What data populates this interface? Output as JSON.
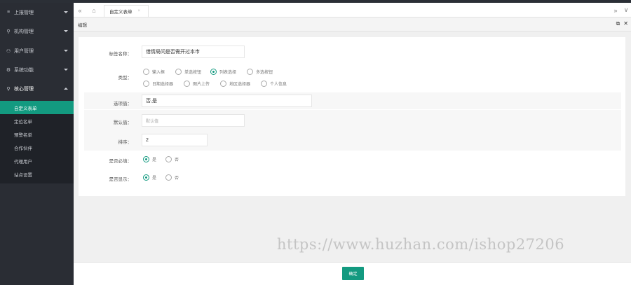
{
  "sidebar": {
    "menu": [
      {
        "icon": "≡",
        "label": "上报管理"
      },
      {
        "icon": "⚲",
        "label": "机构管理"
      },
      {
        "icon": "⚇",
        "label": "用户管理"
      },
      {
        "icon": "⚙",
        "label": "系统功能"
      },
      {
        "icon": "⚲",
        "label": "核心管理"
      }
    ],
    "submenu": [
      "自定义表单",
      "定位名单",
      "预警名单",
      "合作伙伴",
      "代理用户",
      "站点设置"
    ]
  },
  "tabbar": {
    "prev": "«",
    "home": "⌂",
    "next": "»",
    "dropdown": "∨",
    "tab_label": "自定义表单",
    "tab_close": "×"
  },
  "panel": {
    "title": "编辑",
    "tools": [
      "⧉",
      "✕"
    ]
  },
  "form": {
    "field_name_label": "标签名称：",
    "field_name_value": "借情局问是否需开过本市",
    "type_label": "类型：",
    "type_options": [
      "输入框",
      "单选按钮",
      "列表选择",
      "多选按钮",
      "日期选择器",
      "图片上传",
      "地区选择器",
      "个人信息"
    ],
    "type_selected": "列表选择",
    "options_label": "选项值：",
    "options_value": "否,是",
    "default_label": "默认值：",
    "default_placeholder": "默认值",
    "sort_label": "排序：",
    "sort_value": "2",
    "required_label": "是否必填：",
    "show_label": "是否显示：",
    "yes": "是",
    "no": "否"
  },
  "footer": {
    "confirm": "确定"
  },
  "watermark": "https://www.huzhan.com/ishop27206"
}
